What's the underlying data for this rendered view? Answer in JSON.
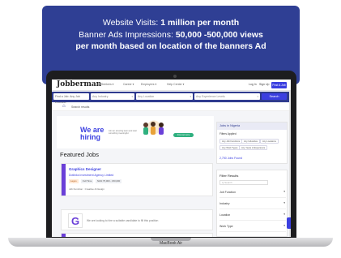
{
  "banner": {
    "line1_prefix": "Website Visits: ",
    "line1_value": "1 million per month",
    "line2_prefix": "Banner Ads Impressions: ",
    "line2_value": "50,000 -500,000 views",
    "line3": "per month based on location of the banners Ad"
  },
  "laptop": {
    "brand": "MacBook Air"
  },
  "nav": {
    "logo": "Jobberman",
    "menu": [
      "All Seekers ▾",
      "Career ▾",
      "Employers ▾",
      "Help Center ▾"
    ],
    "login": "Log In",
    "signup": "Sign Up",
    "post_job": "Post A Job"
  },
  "search": {
    "find_label": "Find a Job:",
    "job_function": "Any Job Function",
    "industry": "Any Industry",
    "location": "Any Location",
    "experience": "Any Experience Levels",
    "button": "Search"
  },
  "breadcrumb": {
    "text": "Search results"
  },
  "hero": {
    "headline_1": "We are",
    "headline_2": "hiring",
    "subtext": "Join an amazing team and start something meaningful.",
    "cta": "Find out more"
  },
  "featured_title": "Featured Jobs",
  "job_card": {
    "title": "Graphics Designer",
    "company": "Dotlinks Investment Agency Limited",
    "tags": [
      "Lagos",
      "Full Time",
      "NGN 75,000 - 150,000"
    ],
    "function": "Job Function : Creative & Design"
  },
  "pager": "1 - 1 of 1 listings",
  "g_card": {
    "letter": "G",
    "message": "We are looking to hire a suitable candidate to fill this position"
  },
  "sidebar": {
    "heading": "Jobs in Nigeria",
    "filters_applied": "Filters Applied",
    "chips": [
      "Any Job Functions",
      "Any Industries",
      "Any Locations",
      "Any Work Types",
      "Any Years of Experience"
    ],
    "found": "2,750 Jobs Found"
  },
  "filter_results": {
    "title": "Filter Results",
    "search_placeholder": "Q  Search",
    "rows": [
      "Job Function",
      "Industry",
      "Location",
      "Work Type"
    ]
  }
}
